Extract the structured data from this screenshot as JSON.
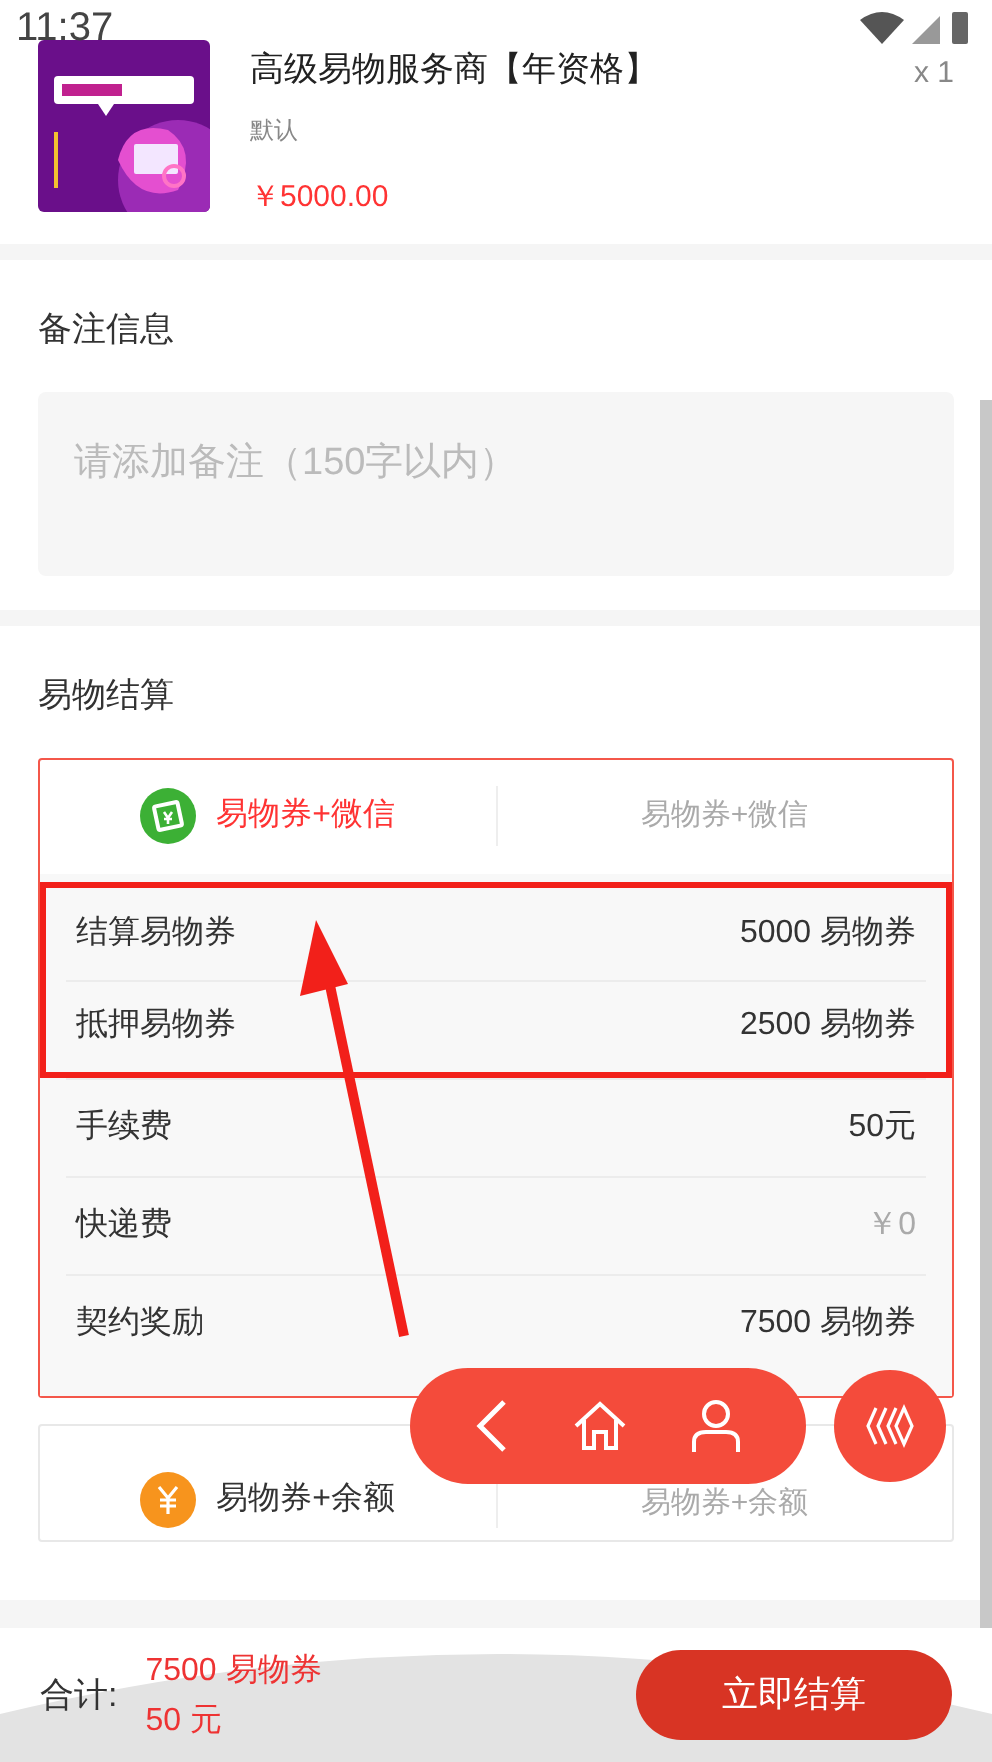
{
  "status_bar": {
    "time": "11:37"
  },
  "product": {
    "title": "高级易物服务商【年资格】",
    "spec": "默认",
    "price": "￥5000.00",
    "quantity": "x 1"
  },
  "remarks": {
    "title": "备注信息",
    "placeholder": "请添加备注（150字以内）"
  },
  "settlement": {
    "title": "易物结算",
    "options": [
      {
        "kind": "wechat",
        "selected": true,
        "label": "易物券+微信",
        "alt_label": "易物券+微信",
        "rows": [
          {
            "label": "结算易物券",
            "value": "5000 易物券",
            "muted": false,
            "highlighted": true
          },
          {
            "label": "抵押易物券",
            "value": "2500 易物券",
            "muted": false,
            "highlighted": true
          },
          {
            "label": "手续费",
            "value": "50元",
            "muted": false,
            "highlighted": false
          },
          {
            "label": "快递费",
            "value": "￥0",
            "muted": true,
            "highlighted": false
          },
          {
            "label": "契约奖励",
            "value": "7500 易物券",
            "muted": false,
            "highlighted": false
          }
        ]
      },
      {
        "kind": "balance",
        "selected": false,
        "label": "易物券+余额",
        "alt_label": "易物券+余额"
      }
    ]
  },
  "footer": {
    "total_label": "合计:",
    "total_lines": [
      "7500 易物券",
      "50 元"
    ],
    "submit": "立即结算"
  }
}
